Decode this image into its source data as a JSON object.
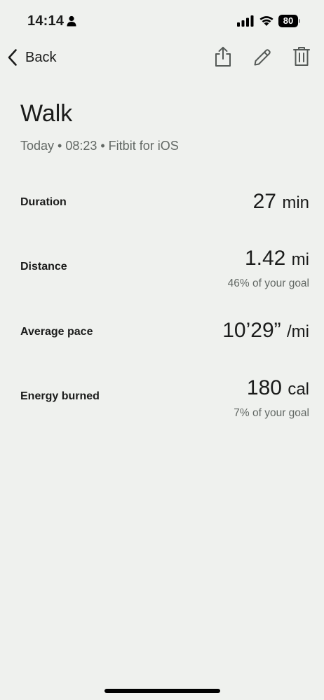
{
  "status_bar": {
    "time": "14:14",
    "battery": "80",
    "icons": [
      "person-icon",
      "cellular-signal-icon",
      "wifi-icon",
      "battery-icon"
    ]
  },
  "nav": {
    "back_label": "Back",
    "icons": [
      "chevron-left-icon",
      "share-icon",
      "pencil-icon",
      "trash-icon"
    ]
  },
  "activity": {
    "title": "Walk",
    "subtitle": "Today • 08:23 • Fitbit for iOS"
  },
  "stats": {
    "duration": {
      "label": "Duration",
      "value": "27",
      "unit": "min"
    },
    "distance": {
      "label": "Distance",
      "value": "1.42",
      "unit": "mi",
      "goal": "46% of your goal"
    },
    "pace": {
      "label": "Average pace",
      "value": "10’29”",
      "unit": "/mi"
    },
    "energy": {
      "label": "Energy burned",
      "value": "180",
      "unit": "cal",
      "goal": "7% of your goal"
    }
  },
  "colors": {
    "background": "#eff1ee",
    "text_primary": "#1b1c1b",
    "text_secondary": "#626864"
  }
}
